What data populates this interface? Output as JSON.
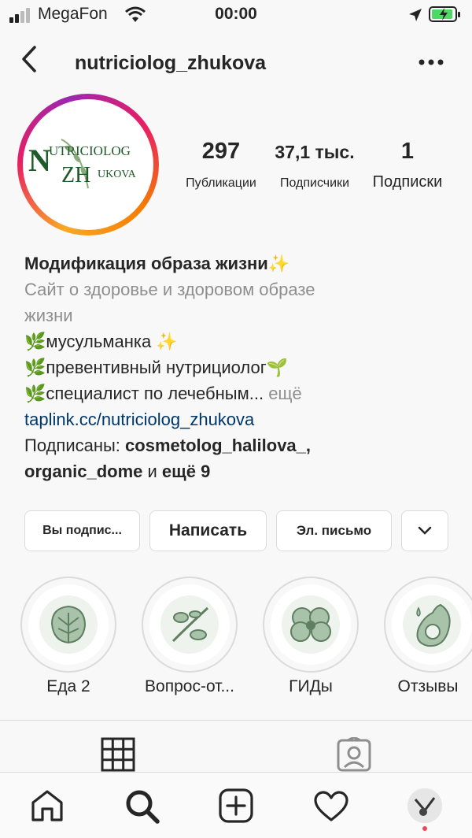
{
  "status_bar": {
    "carrier": "MegaFon",
    "time": "00:00"
  },
  "header": {
    "username": "nutriciolog_zhukova"
  },
  "avatar": {
    "logo_text_top": "UTRICIOLOG",
    "logo_text_n": "N",
    "logo_text_zh": "ZH",
    "logo_text_ukova": "UKOVA"
  },
  "stats": {
    "posts": {
      "value": "297",
      "label": "Публикации"
    },
    "followers": {
      "value": "37,1 тыс.",
      "label": "Подписчики"
    },
    "following": {
      "value": "1",
      "label": "Подписки"
    }
  },
  "bio": {
    "name": "Модификация образа жизни✨",
    "category": "Сайт о здоровье и здоровом образе",
    "category_line2": "жизни",
    "line1": "🌿мусульманка ✨",
    "line2": "🌿превентивный нутрициолог🌱",
    "line3": "🌿специалист по лечебным...",
    "more": "ещё",
    "link": "taplink.cc/nutriciolog_zhukova",
    "followed_by_prefix": "Подписаны:",
    "followed_by_1": "cosmetolog_halilova_,",
    "followed_by_2": "organic_dome",
    "followed_by_and": "и",
    "followed_by_more": "ещё 9"
  },
  "buttons": {
    "following": "Вы подпис...",
    "message": "Написать",
    "email": "Эл. письмо"
  },
  "highlights": [
    {
      "label": "Еда 2",
      "icon": "leaf-icon"
    },
    {
      "label": "Вопрос-от...",
      "icon": "plant-icon"
    },
    {
      "label": "ГИДы",
      "icon": "flower-icon"
    },
    {
      "label": "Отзывы",
      "icon": "avocado-icon"
    }
  ],
  "colors": {
    "link": "#00376b",
    "icon_green": "#7a9a7e",
    "text": "#262626",
    "secondary": "#8e8e8e"
  }
}
